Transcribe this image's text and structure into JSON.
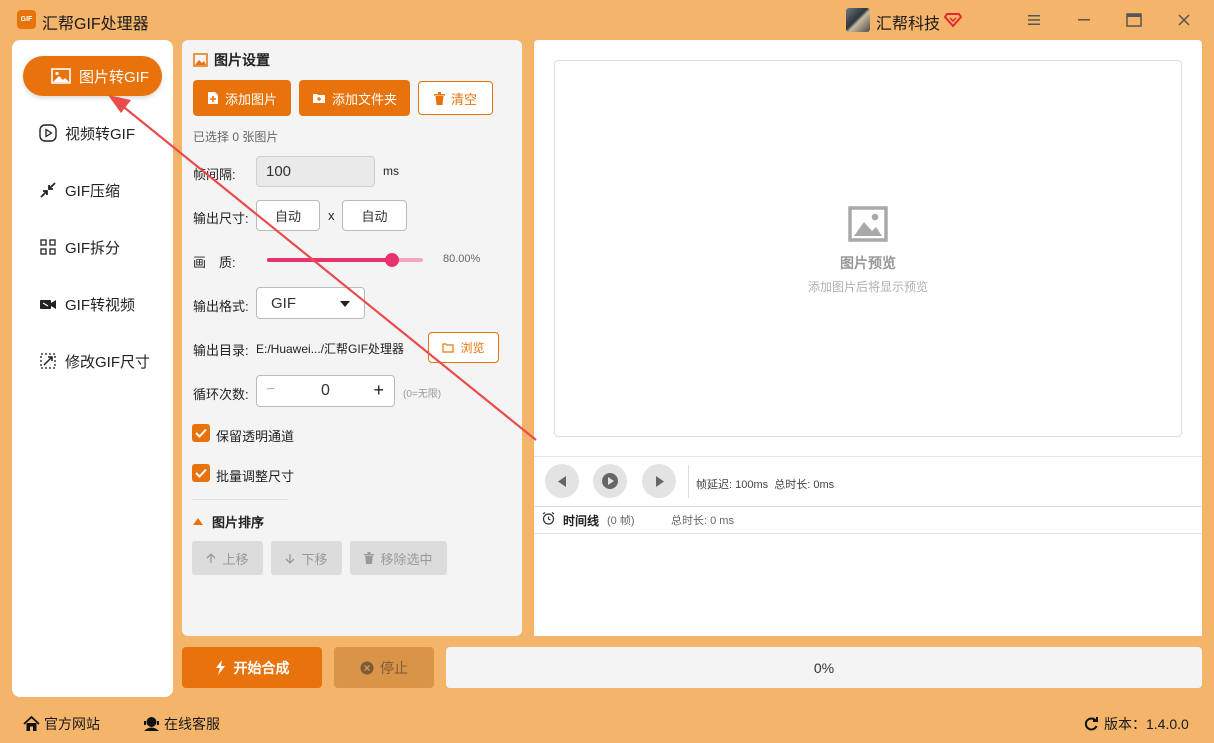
{
  "app": {
    "logo_text": "GIF",
    "title": "汇帮GIF处理器",
    "user_name": "汇帮科技"
  },
  "colors": {
    "accent": "#e8730c",
    "background": "#f4b46a",
    "slider": "#e8336d"
  },
  "sidebar": {
    "items": [
      {
        "label": "图片转GIF",
        "icon": "image-icon",
        "active": true
      },
      {
        "label": "视频转GIF",
        "icon": "play-circle-icon"
      },
      {
        "label": "GIF压缩",
        "icon": "compress-icon"
      },
      {
        "label": "GIF拆分",
        "icon": "split-icon"
      },
      {
        "label": "GIF转视频",
        "icon": "video-icon"
      },
      {
        "label": "修改GIF尺寸",
        "icon": "resize-icon"
      }
    ]
  },
  "settings": {
    "title": "图片设置",
    "add_image": "添加图片",
    "add_folder": "添加文件夹",
    "clear": "清空",
    "selected_count": "已选择 0 张图片",
    "interval_label": "帧间隔:",
    "interval_value": "100",
    "interval_unit": "ms",
    "size_label": "输出尺寸:",
    "width": "自动",
    "size_x": "x",
    "height": "自动",
    "quality_label": "画　质:",
    "quality_value": "80.00%",
    "quality_fraction": 0.8,
    "format_label": "输出格式:",
    "format_value": "GIF",
    "dir_label": "输出目录:",
    "dir_value": "E:/Huawei.../汇帮GIF处理器",
    "browse": "浏览",
    "loop_label": "循环次数:",
    "loop_minus": "−",
    "loop_value": "0",
    "loop_plus": "+",
    "loop_hint": "(0=无限)",
    "keep_alpha": "保留透明通道",
    "batch_resize": "批量调整尺寸",
    "sort_title": "图片排序",
    "move_up": "上移",
    "move_down": "下移",
    "remove_selected": "移除选中"
  },
  "preview": {
    "title": "图片预览",
    "hint": "添加图片后将显示预览",
    "frame_info": "帧延迟: 100ms  总时长: 0ms",
    "timeline_label": "时间线",
    "timeline_count": "(0 帧)",
    "timeline_duration": "总时长: 0 ms"
  },
  "actions": {
    "start": "开始合成",
    "stop": "停止",
    "progress_text": "0%",
    "progress": 0
  },
  "footer": {
    "website": "官方网站",
    "support": "在线客服",
    "version": "版本：1.4.0.0"
  }
}
